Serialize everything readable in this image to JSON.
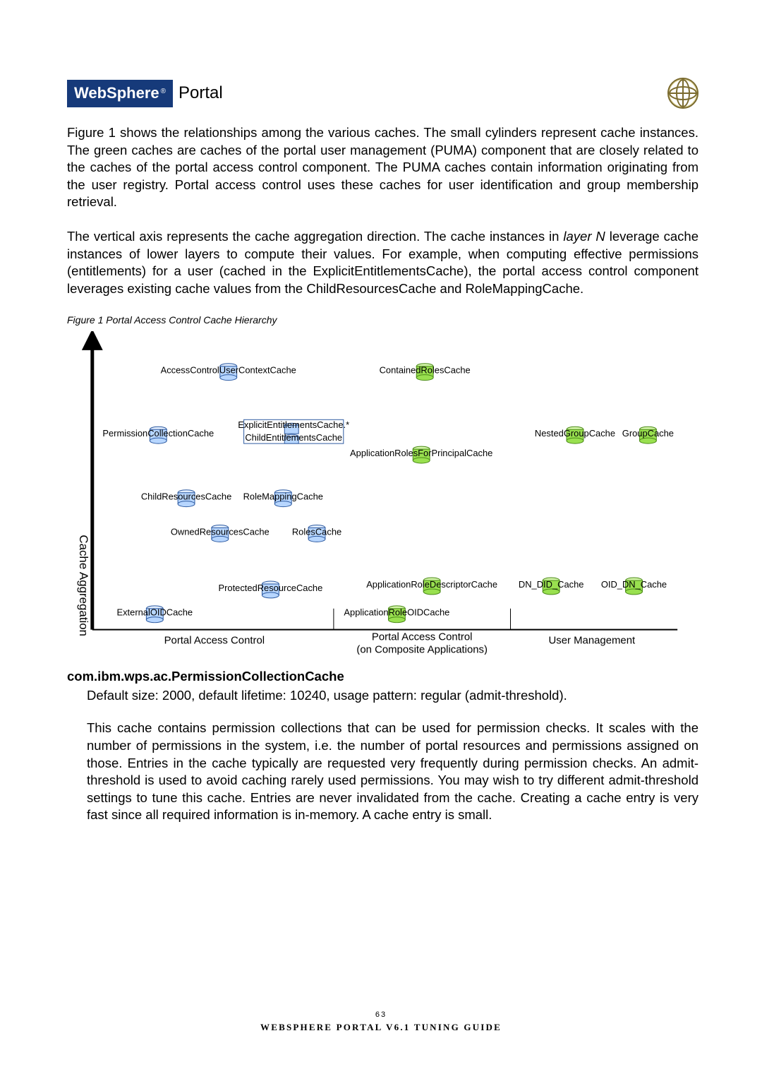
{
  "header": {
    "brand": "WebSphere",
    "brand_suffix": "®",
    "product": "Portal"
  },
  "paragraphs": {
    "p1": "Figure 1 shows the relationships among the various caches. The small cylinders represent cache instances. The green caches are caches of the portal user management (PUMA) component that are closely related to the caches of the portal access control component. The PUMA caches contain information originating from the user registry. Portal access control uses these caches for user identification and group membership retrieval.",
    "p2a": "The vertical axis represents the cache aggregation direction. The cache instances in ",
    "p2_layer": "layer N",
    "p2b": " leverage cache instances of lower layers to compute their values. For example, when computing effective permissions (entitlements) for a user (cached in the ExplicitEntitlementsCache), the portal access control component leverages existing cache values from the ChildResourcesCache and RoleMappingCache."
  },
  "figure_caption": "Figure 1 Portal Access Control Cache Hierarchy",
  "chart_data": {
    "type": "diagram",
    "axis_label": "Cache Aggregation",
    "columns": [
      {
        "label": "Portal Access Control"
      },
      {
        "label": "Portal Access Control",
        "sublabel": "(on Composite Applications)"
      },
      {
        "label": "User Management"
      }
    ],
    "layers": [
      {
        "level": 5,
        "nodes": [
          {
            "id": "AccessControlUserContextCache",
            "col": 0,
            "color": "blue"
          },
          {
            "id": "ContainedRolesCache",
            "col": 1,
            "color": "green"
          }
        ]
      },
      {
        "level": 4,
        "nodes": [
          {
            "id": "PermissionCollectionCache",
            "col": 0,
            "color": "blue"
          },
          {
            "id": "ExplicitEntitlementsCache.*",
            "col": 0,
            "color": "blue"
          },
          {
            "id": "ChildEntitlementsCache",
            "col": 0,
            "color": "blue"
          },
          {
            "id": "ApplicationRolesForPrincipalCache",
            "col": 1,
            "color": "green"
          },
          {
            "id": "NestedGroupCache",
            "col": 2,
            "color": "green"
          },
          {
            "id": "GroupCache",
            "col": 2,
            "color": "green"
          }
        ]
      },
      {
        "level": 3,
        "nodes": [
          {
            "id": "ChildResourcesCache",
            "col": 0,
            "color": "blue"
          },
          {
            "id": "RoleMappingCache",
            "col": 0,
            "color": "blue"
          }
        ]
      },
      {
        "level": 2,
        "nodes": [
          {
            "id": "OwnedResourcesCache",
            "col": 0,
            "color": "blue"
          },
          {
            "id": "RolesCache",
            "col": 0,
            "color": "blue"
          }
        ]
      },
      {
        "level": 1,
        "nodes": [
          {
            "id": "ExternalOIDCache",
            "col": 0,
            "color": "blue"
          },
          {
            "id": "ProtectedResourceCache",
            "col": 0,
            "color": "blue"
          },
          {
            "id": "ApplicationRoleDescriptorCache",
            "col": 1,
            "color": "green"
          },
          {
            "id": "ApplicationRoleOIDCache",
            "col": 1,
            "color": "green"
          },
          {
            "id": "DN_DID_Cache",
            "col": 2,
            "color": "green"
          },
          {
            "id": "OID_DN_Cache",
            "col": 2,
            "color": "green"
          }
        ]
      }
    ]
  },
  "section": {
    "heading": "com.ibm.wps.ac.PermissionCollectionCache",
    "line1": "Default size: 2000, default lifetime: 10240, usage pattern: regular (admit-threshold).",
    "body": "This cache contains permission collections that can be used for permission checks. It scales with the number of permissions in the system, i.e. the number of portal resources and permissions assigned on those. Entries in the cache typically are requested very frequently during permission checks.  An admit-threshold is used to avoid caching rarely used permissions.  You may wish to try different admit-threshold settings to tune this cache. Entries are never invalidated from the cache. Creating a cache entry is very fast since all required information is in-memory. A cache entry is small."
  },
  "footer": {
    "page_number": "63",
    "title": "WEBSPHERE PORTAL V6.1 TUNING GUIDE"
  }
}
